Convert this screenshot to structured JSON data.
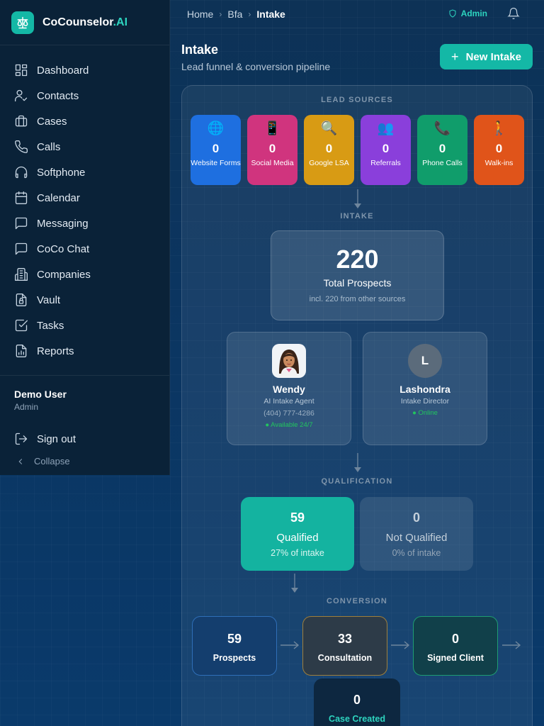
{
  "brand": {
    "name": "CoCounselor",
    "accent": ".AI"
  },
  "sidebar": {
    "items": [
      {
        "label": "Dashboard",
        "icon": "dashboard-icon"
      },
      {
        "label": "Contacts",
        "icon": "contacts-icon"
      },
      {
        "label": "Cases",
        "icon": "briefcase-icon"
      },
      {
        "label": "Calls",
        "icon": "phone-icon"
      },
      {
        "label": "Softphone",
        "icon": "headset-icon"
      },
      {
        "label": "Calendar",
        "icon": "calendar-icon"
      },
      {
        "label": "Messaging",
        "icon": "message-icon"
      },
      {
        "label": "CoCo Chat",
        "icon": "chat-icon"
      },
      {
        "label": "Companies",
        "icon": "building-icon"
      },
      {
        "label": "Vault",
        "icon": "file-lock-icon"
      },
      {
        "label": "Tasks",
        "icon": "checkbox-icon"
      },
      {
        "label": "Reports",
        "icon": "report-icon"
      }
    ],
    "user": {
      "name": "Demo User",
      "role": "Admin"
    },
    "sign_out": "Sign out",
    "collapse": "Collapse"
  },
  "topbar": {
    "breadcrumb": [
      "Home",
      "Bfa",
      "Intake"
    ],
    "admin_label": "Admin"
  },
  "header": {
    "title": "Intake",
    "subtitle": "Lead funnel & conversion pipeline",
    "new_button": "New Intake"
  },
  "funnel": {
    "sections": {
      "lead_sources": "LEAD SOURCES",
      "intake": "INTAKE",
      "qualification": "QUALIFICATION",
      "conversion": "CONVERSION"
    },
    "sources": [
      {
        "icon": "🌐",
        "count": "0",
        "label": "Website Forms",
        "color": "#1e6fe0"
      },
      {
        "icon": "📱",
        "count": "0",
        "label": "Social Media",
        "color": "#d0347e"
      },
      {
        "icon": "🔍",
        "count": "0",
        "label": "Google LSA",
        "color": "#d89b14"
      },
      {
        "icon": "👥",
        "count": "0",
        "label": "Referrals",
        "color": "#8a3fdb"
      },
      {
        "icon": "📞",
        "count": "0",
        "label": "Phone Calls",
        "color": "#109d6b"
      },
      {
        "icon": "🚶",
        "count": "0",
        "label": "Walk-ins",
        "color": "#e0541a"
      }
    ],
    "total": {
      "value": "220",
      "label": "Total Prospects",
      "note": "incl. 220 from other sources"
    },
    "agents": [
      {
        "name": "Wendy",
        "role": "AI Intake Agent",
        "phone": "(404) 777-4286",
        "status": "● Available 24/7"
      },
      {
        "initial": "L",
        "name": "Lashondra",
        "role": "Intake Director",
        "status": "● Online"
      }
    ],
    "qualification": [
      {
        "value": "59",
        "label": "Qualified",
        "pct": "27% of intake"
      },
      {
        "value": "0",
        "label": "Not Qualified",
        "pct": "0% of intake"
      }
    ],
    "conversion": [
      {
        "value": "59",
        "label": "Prospects"
      },
      {
        "value": "33",
        "label": "Consultation"
      },
      {
        "value": "0",
        "label": "Signed Client"
      }
    ],
    "case_created": {
      "value": "0",
      "label": "Case Created"
    }
  },
  "colors": {
    "accent": "#14b8a6",
    "qualified": "#14b3a0",
    "prospects_border": "#2f6fb8",
    "consultation_border": "#a07f3a",
    "signed_border": "#1f9d72"
  }
}
